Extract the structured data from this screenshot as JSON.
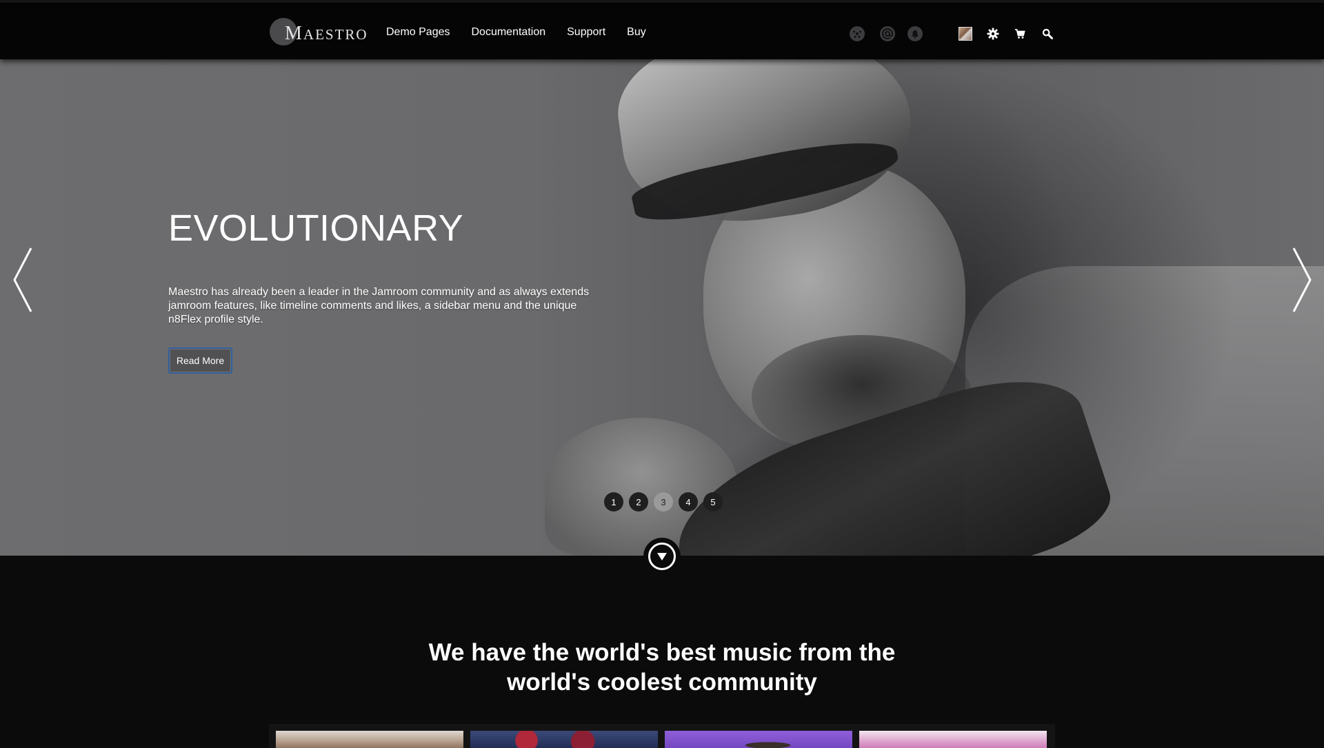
{
  "header": {
    "logo_text": "MAESTRO",
    "nav": [
      "Demo Pages",
      "Documentation",
      "Support",
      "Buy"
    ],
    "icons": [
      "network-icon",
      "at-mention-icon",
      "notification-icon",
      "user-avatar",
      "gear-icon",
      "cart-icon",
      "search-icon"
    ]
  },
  "hero": {
    "title": "EVOLUTIONARY",
    "text": "Maestro has already been a leader in the Jamroom community and as always extends jamroom features, like timeline comments and likes, a sidebar menu and the unique n8Flex profile style.",
    "button_label": "Read More",
    "slides": [
      "1",
      "2",
      "3",
      "4",
      "5"
    ],
    "active_slide": "3"
  },
  "tagline": "We have the world's best music from the world's coolest community",
  "colors": {
    "header_bg": "#050505",
    "page_bg": "#0b0b0c",
    "button_border": "#2f5f9c",
    "active_dot": "#9a9a9b"
  }
}
